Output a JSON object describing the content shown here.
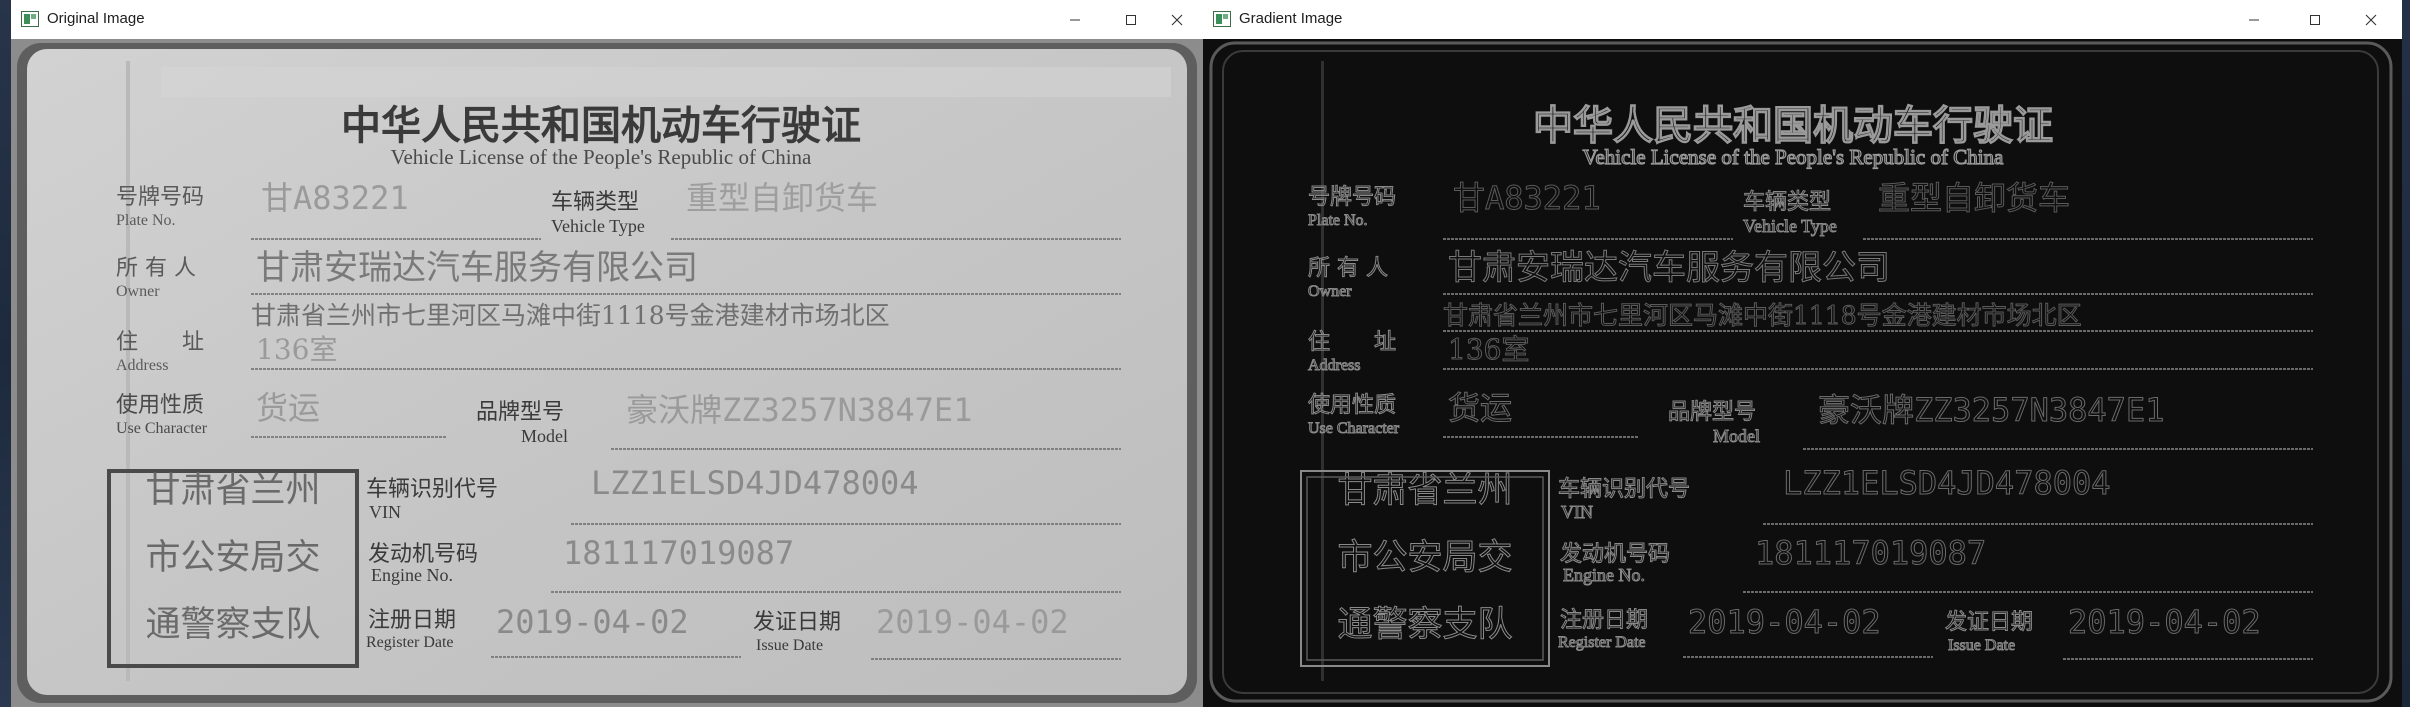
{
  "windows": [
    {
      "title": "Original Image",
      "app_icon": "opencv-window-icon",
      "controls": [
        "minimize-icon",
        "maximize-icon",
        "close-icon"
      ]
    },
    {
      "title": "Gradient Image",
      "app_icon": "opencv-window-icon",
      "controls": [
        "minimize-icon",
        "maximize-icon",
        "close-icon"
      ]
    }
  ],
  "license": {
    "title_cn": "中华人民共和国机动车行驶证",
    "title_en": "Vehicle License of the People's Republic of China",
    "plate_label_cn": "号牌号码",
    "plate_label_en": "Plate No.",
    "plate_value": "甘A83221",
    "type_label_cn": "车辆类型",
    "type_label_en": "Vehicle Type",
    "type_value": "重型自卸货车",
    "owner_label_cn": "所 有 人",
    "owner_label_en": "Owner",
    "owner_value": "甘肃安瑞达汽车服务有限公司",
    "address_label_cn": "住　　址",
    "address_label_en": "Address",
    "address_line1": "甘肃省兰州市七里河区马滩中街1118号金港建材市场北区",
    "address_line2": "136室",
    "use_label_cn": "使用性质",
    "use_label_en": "Use Character",
    "use_value": "货运",
    "model_label_cn": "品牌型号",
    "model_label_en": "Model",
    "model_value": "豪沃牌ZZ3257N3847E1",
    "vin_label_cn": "车辆识别代号",
    "vin_label_en": "VIN",
    "vin_value": "LZZ1ELSD4JD478004",
    "engine_label_cn": "发动机号码",
    "engine_label_en": "Engine No.",
    "engine_value": "181117019087",
    "register_label_cn": "注册日期",
    "register_label_en": "Register Date",
    "register_value": "2019-04-02",
    "issue_label_cn": "发证日期",
    "issue_label_en": "Issue Date",
    "issue_value": "2019-04-02",
    "seal_lines": [
      "甘肃省兰州",
      "市公安局交",
      "通警察支队"
    ]
  },
  "colors": {
    "titlebar": "#ffffff",
    "desktop": "#1b2433",
    "card_bg": "#cbcbcb",
    "card_frame": "#6a6a6a",
    "gradient_bg": "#0e0e0e",
    "gradient_text": "#7e7e7e"
  }
}
